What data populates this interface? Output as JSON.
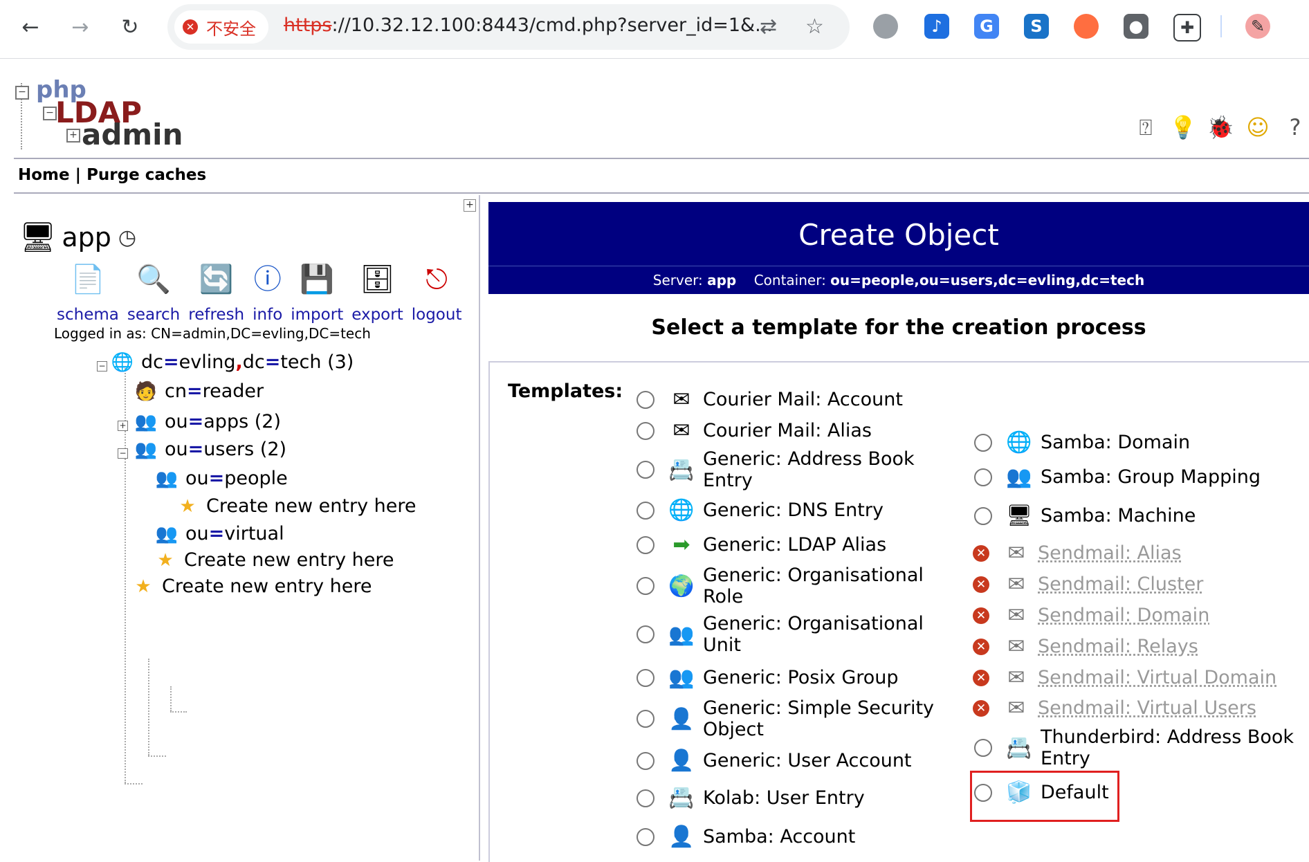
{
  "browser": {
    "insecure_label": "不安全",
    "url_protocol": "https",
    "url_rest": "://10.32.12.100:8443/cmd.php?server_id=1&...",
    "nav": {
      "back": "←",
      "forward": "→",
      "reload": "↻"
    }
  },
  "header": {
    "logo": {
      "line1": "php",
      "line2": "LDAP",
      "line3": "admin"
    },
    "menu": {
      "home": "Home",
      "sep": "|",
      "purge": "Purge caches"
    }
  },
  "left": {
    "server_name": "app",
    "tools": [
      {
        "label": "schema",
        "icon": "schema-icon"
      },
      {
        "label": "search",
        "icon": "search-icon"
      },
      {
        "label": "refresh",
        "icon": "refresh-icon"
      },
      {
        "label": "info",
        "icon": "info-icon"
      },
      {
        "label": "import",
        "icon": "import-icon"
      },
      {
        "label": "export",
        "icon": "export-icon"
      },
      {
        "label": "logout",
        "icon": "logout-icon"
      }
    ],
    "logged_in": "Logged in as: CN=admin,DC=evling,DC=tech",
    "tree": {
      "root": {
        "a": "dc",
        "b": "evling",
        "c": "dc",
        "d": "tech",
        "count": "(3)"
      },
      "reader": {
        "a": "cn",
        "b": "reader"
      },
      "apps": {
        "a": "ou",
        "b": "apps",
        "count": "(2)"
      },
      "users": {
        "a": "ou",
        "b": "users",
        "count": "(2)"
      },
      "people": {
        "a": "ou",
        "b": "people"
      },
      "virtual": {
        "a": "ou",
        "b": "virtual"
      },
      "create": "Create new entry here"
    }
  },
  "main": {
    "title": "Create Object",
    "server_label": "Server:",
    "server_value": "app",
    "container_label": "Container:",
    "container_value": "ou=people,ou=users,dc=evling,dc=tech",
    "heading": "Select a template for the creation process",
    "templates_label": "Templates:",
    "left_templates": [
      {
        "line1": "Courier Mail: Account",
        "line2": ""
      },
      {
        "line1": "Courier Mail: Alias",
        "line2": ""
      },
      {
        "line1": "Generic: Address Book",
        "line2": "Entry"
      },
      {
        "line1": "Generic: DNS Entry",
        "line2": ""
      },
      {
        "line1": "Generic: LDAP Alias",
        "line2": ""
      },
      {
        "line1": "Generic: Organisational",
        "line2": "Role"
      },
      {
        "line1": "Generic: Organisational",
        "line2": "Unit"
      },
      {
        "line1": "Generic: Posix Group",
        "line2": ""
      },
      {
        "line1": "Generic: Simple Security",
        "line2": "Object"
      },
      {
        "line1": "Generic: User Account",
        "line2": ""
      },
      {
        "line1": "Kolab: User Entry",
        "line2": ""
      },
      {
        "line1": "Samba: Account",
        "line2": ""
      }
    ],
    "right_templates": [
      {
        "line1": "Samba: Domain",
        "line2": "",
        "disabled": false
      },
      {
        "line1": "Samba: Group Mapping",
        "line2": "",
        "disabled": false
      },
      {
        "line1": "Samba: Machine",
        "line2": "",
        "disabled": false
      },
      {
        "line1": "Sendmail: Alias",
        "line2": "",
        "disabled": true
      },
      {
        "line1": "Sendmail: Cluster",
        "line2": "",
        "disabled": true
      },
      {
        "line1": "Sendmail: Domain",
        "line2": "",
        "disabled": true
      },
      {
        "line1": "Sendmail: Relays",
        "line2": "",
        "disabled": true
      },
      {
        "line1": "Sendmail: Virtual Domain",
        "line2": "",
        "disabled": true
      },
      {
        "line1": "Sendmail: Virtual Users",
        "line2": "",
        "disabled": true
      },
      {
        "line1": "Thunderbird: Address Book",
        "line2": "Entry",
        "disabled": false
      },
      {
        "line1": "Default",
        "line2": "",
        "disabled": false
      }
    ]
  },
  "colors": {
    "title_bar": "#000080",
    "link": "#1a1aa6",
    "disabled": "#c8391e",
    "highlight": "#e02020"
  }
}
